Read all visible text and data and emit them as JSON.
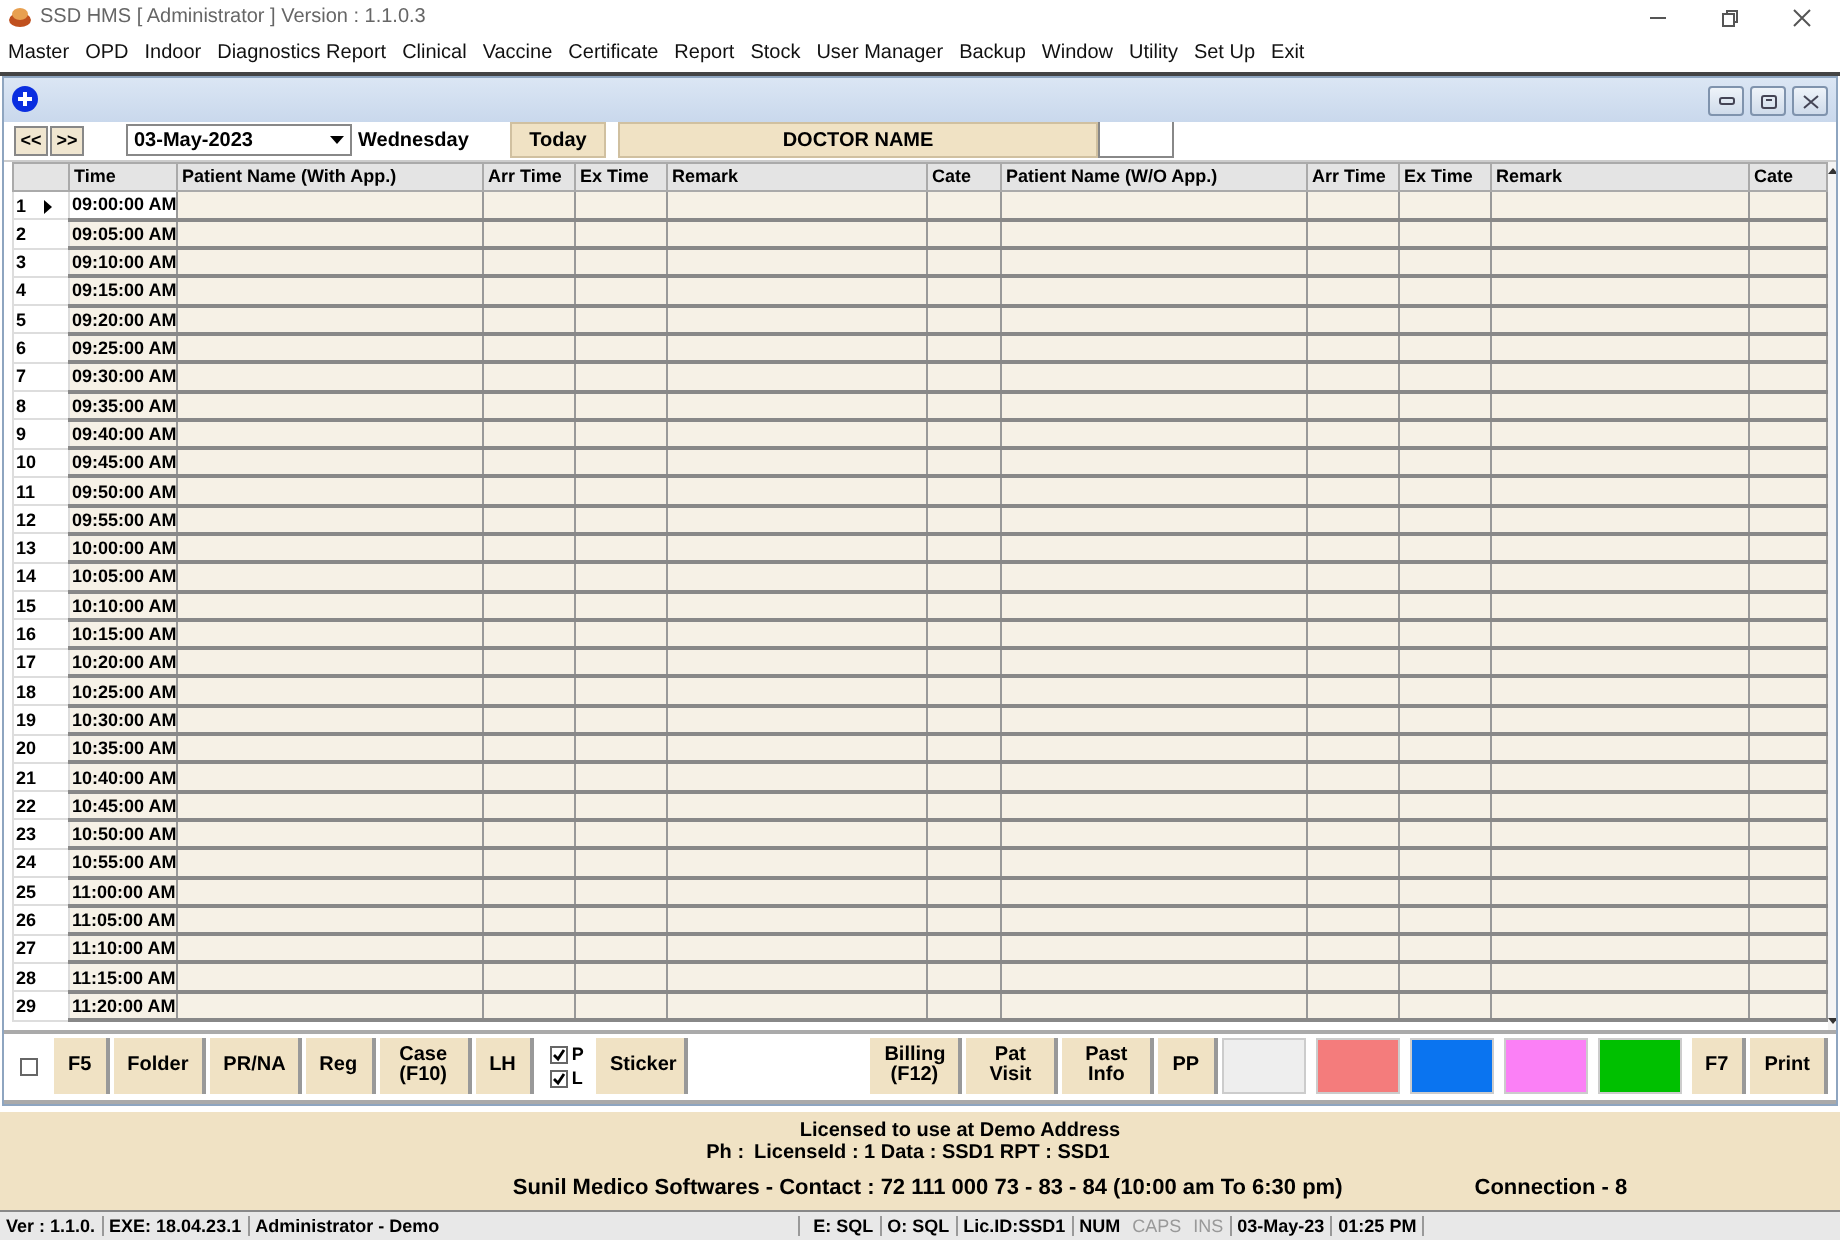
{
  "window": {
    "title": "SSD HMS [ Administrator ] Version : 1.1.0.3"
  },
  "menu": [
    "Master",
    "OPD",
    "Indoor",
    "Diagnostics Report",
    "Clinical",
    "Vaccine",
    "Certificate",
    "Report",
    "Stock",
    "User Manager",
    "Backup",
    "Window",
    "Utility",
    "Set Up",
    "Exit"
  ],
  "toolbar": {
    "prev": "<<",
    "next": ">>",
    "date": "03-May-2023",
    "weekday": "Wednesday",
    "today": "Today",
    "doctor": "DOCTOR NAME"
  },
  "table": {
    "columns": [
      "Time",
      "Patient Name (With App.)",
      "Arr Time",
      "Ex Time",
      "Remark",
      "Cate",
      "Patient Name (W/O App.)",
      "Arr Time",
      "Ex Time",
      "Remark",
      "Cate"
    ],
    "rows": [
      {
        "number": "1",
        "time": "09:00:00 AM",
        "selected": true
      },
      {
        "number": "2",
        "time": "09:05:00 AM",
        "selected": false
      },
      {
        "number": "3",
        "time": "09:10:00 AM",
        "selected": false
      },
      {
        "number": "4",
        "time": "09:15:00 AM",
        "selected": false
      },
      {
        "number": "5",
        "time": "09:20:00 AM",
        "selected": false
      },
      {
        "number": "6",
        "time": "09:25:00 AM",
        "selected": false
      },
      {
        "number": "7",
        "time": "09:30:00 AM",
        "selected": false
      },
      {
        "number": "8",
        "time": "09:35:00 AM",
        "selected": false
      },
      {
        "number": "9",
        "time": "09:40:00 AM",
        "selected": false
      },
      {
        "number": "10",
        "time": "09:45:00 AM",
        "selected": false
      },
      {
        "number": "11",
        "time": "09:50:00 AM",
        "selected": false
      },
      {
        "number": "12",
        "time": "09:55:00 AM",
        "selected": false
      },
      {
        "number": "13",
        "time": "10:00:00 AM",
        "selected": false
      },
      {
        "number": "14",
        "time": "10:05:00 AM",
        "selected": false
      },
      {
        "number": "15",
        "time": "10:10:00 AM",
        "selected": false
      },
      {
        "number": "16",
        "time": "10:15:00 AM",
        "selected": false
      },
      {
        "number": "17",
        "time": "10:20:00 AM",
        "selected": false
      },
      {
        "number": "18",
        "time": "10:25:00 AM",
        "selected": false
      },
      {
        "number": "19",
        "time": "10:30:00 AM",
        "selected": false
      },
      {
        "number": "20",
        "time": "10:35:00 AM",
        "selected": false
      },
      {
        "number": "21",
        "time": "10:40:00 AM",
        "selected": false
      },
      {
        "number": "22",
        "time": "10:45:00 AM",
        "selected": false
      },
      {
        "number": "23",
        "time": "10:50:00 AM",
        "selected": false
      },
      {
        "number": "24",
        "time": "10:55:00 AM",
        "selected": false
      },
      {
        "number": "25",
        "time": "11:00:00 AM",
        "selected": false
      },
      {
        "number": "26",
        "time": "11:05:00 AM",
        "selected": false
      },
      {
        "number": "27",
        "time": "11:10:00 AM",
        "selected": false
      },
      {
        "number": "28",
        "time": "11:15:00 AM",
        "selected": false
      },
      {
        "number": "29",
        "time": "11:20:00 AM",
        "selected": false
      }
    ]
  },
  "bottom_bar": {
    "left": [
      {
        "kind": "checkbox",
        "checked": false
      },
      {
        "kind": "button",
        "label": "F5"
      },
      {
        "kind": "button",
        "label": "Folder"
      },
      {
        "kind": "button",
        "label": "PR/NA"
      },
      {
        "kind": "button",
        "label": "Reg"
      },
      {
        "kind": "button",
        "label": "Case (F10)"
      },
      {
        "kind": "button",
        "label": "LH"
      },
      {
        "kind": "checks",
        "options": [
          {
            "label": "P",
            "checked": true
          },
          {
            "label": "L",
            "checked": true
          }
        ]
      },
      {
        "kind": "button",
        "label": "Sticker"
      }
    ],
    "right": [
      {
        "kind": "button",
        "label": "Billing (F12)"
      },
      {
        "kind": "button",
        "label": "Pat Visit"
      },
      {
        "kind": "button",
        "label": "Past Info"
      },
      {
        "kind": "button",
        "label": "PP"
      },
      {
        "kind": "swatch",
        "color": "#eeeeee"
      },
      {
        "kind": "swatch",
        "color": "#f47c7c"
      },
      {
        "kind": "swatch",
        "color": "#0a74f0"
      },
      {
        "kind": "swatch",
        "color": "#fb80f6"
      },
      {
        "kind": "swatch",
        "color": "#00c000"
      },
      {
        "kind": "button",
        "label": "F7"
      },
      {
        "kind": "button",
        "label": "Print"
      }
    ]
  },
  "info": {
    "license": "Licensed to use at Demo Address",
    "phone_label": "Ph :",
    "license_details": "LicenseId : 1  Data : SSD1 RPT : SSD1",
    "contact": "Sunil Medico Softwares - Contact : 72 111 000 73 - 83 - 84  (10:00 am To 6:30 pm)",
    "connection": "Connection - 8"
  },
  "status_bar": [
    {
      "text": "Ver : 1.1.0.",
      "disabled": false
    },
    {
      "text": "EXE: 18.04.23.1",
      "disabled": false
    },
    {
      "text": "Administrator - Demo",
      "disabled": false
    },
    {
      "text": "E: SQL",
      "disabled": false
    },
    {
      "text": "O: SQL",
      "disabled": false
    },
    {
      "text": "Lic.ID:SSD1",
      "disabled": false
    },
    {
      "text": "NUM",
      "disabled": false
    },
    {
      "text": "CAPS",
      "disabled": true
    },
    {
      "text": "INS",
      "disabled": true
    },
    {
      "text": "03-May-23",
      "disabled": false
    },
    {
      "text": "01:25 PM",
      "disabled": false
    }
  ]
}
